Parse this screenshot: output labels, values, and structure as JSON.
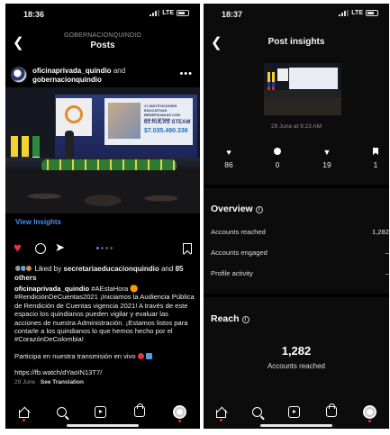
{
  "left": {
    "status": {
      "time": "18:36",
      "network": "LTE"
    },
    "header": {
      "account": "GOBERNACIONQUINDIO",
      "title": "Posts"
    },
    "post": {
      "author": "oficinaprivada_quindio",
      "and_text": "and",
      "coauthor": "gobernacionquindio",
      "photo": {
        "screen_line1": "17 INSTITUCIONES EDUCATIVAS BENEFICIADAS CON AULAS STEAM",
        "screen_line2": "63 AULAS STEAM",
        "screen_line3": "$7.035.490.336"
      },
      "view_insights": "View Insights",
      "likes_prefix": "Liked by",
      "likes_user": "secretariaeducacionquindio",
      "likes_and": "and",
      "likes_count": "85 others",
      "caption_author": "oficinaprivada_quindio",
      "caption_text": "#AEstaHora 🟠 #RendiciónDeCuentas2021 ¡Iniciamos la Audiencia Pública de Rendición de Cuentas vigencia 2021! A través de este espacio los quindianos pueden vigilar y evaluar las acciones de nuestra Administración. ¡Estamos listos para contarle a los quindianos lo que hemos hecho por el #CorazónDeColombia!",
      "caption_live": "Participa en nuestra transmisión en vivo",
      "caption_link": "https://fb.watch/dYaoIN13T7/",
      "date": "29 June",
      "see_translation": "See Translation"
    }
  },
  "right": {
    "status": {
      "time": "18:37",
      "network": "LTE"
    },
    "header": {
      "title": "Post insights"
    },
    "date": "29 June at 9:23 AM",
    "stats": {
      "likes": "86",
      "comments": "0",
      "shares": "19",
      "saves": "1"
    },
    "overview": {
      "title": "Overview",
      "rows": [
        {
          "label": "Accounts reached",
          "value": "1,282"
        },
        {
          "label": "Accounts engaged",
          "value": "–"
        },
        {
          "label": "Profile activity",
          "value": "–"
        }
      ]
    },
    "reach": {
      "title": "Reach",
      "value": "1,282",
      "label": "Accounts reached"
    }
  },
  "colors": {
    "like_red": "#ed2d49",
    "link_blue": "#4b8cf5",
    "background": "#000000"
  },
  "icons": [
    "back-arrow-icon",
    "more-icon",
    "heart-icon",
    "comment-icon",
    "share-icon",
    "bookmark-icon",
    "home-icon",
    "search-icon",
    "reels-icon",
    "shop-icon",
    "profile-icon",
    "info-icon"
  ]
}
